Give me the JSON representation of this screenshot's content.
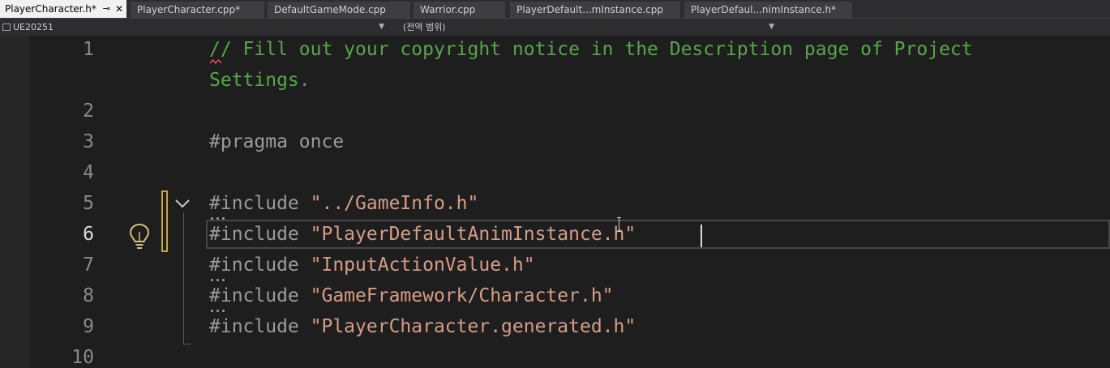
{
  "tabs": [
    {
      "label": "PlayerCharacter.h*",
      "active": true
    },
    {
      "label": "PlayerCharacter.cpp*"
    },
    {
      "label": "DefaultGameMode.cpp"
    },
    {
      "label": "Warrior.cpp"
    },
    {
      "label": "PlayerDefault...mInstance.cpp"
    },
    {
      "label": "PlayerDefaul...nimInstance.h*"
    }
  ],
  "tab_icons": {
    "pin": "⊸",
    "close": "✕"
  },
  "navbar": {
    "project": "UE20251",
    "scope": "(전역 범위)",
    "member": ""
  },
  "editor": {
    "current_line": 6,
    "line_numbers": [
      "1",
      "2",
      "3",
      "4",
      "5",
      "6",
      "7",
      "8",
      "9",
      "10"
    ],
    "lines": {
      "l1a": "// Fill out your copyright notice in the Description page of Project",
      "l1b": "Settings.",
      "l3_kw": "#pragma",
      "l3_rest": " once",
      "l5_kw": "#include",
      "l5_str": "\"../GameInfo.h\"",
      "l6_kw": "#include",
      "l6_str": "\"PlayerDefaultAnimInstance.h\"",
      "l7_kw": "#include",
      "l7_str": "\"InputActionValue.h\"",
      "l8_kw": "#include",
      "l8_str": "\"GameFramework/Character.h\"",
      "l9_kw": "#include",
      "l9_str": "\"PlayerCharacter.generated.h\""
    }
  },
  "colors": {
    "comment": "#57a64a",
    "string": "#d69d85",
    "change_bar": "#c8a93b",
    "background": "#1e1e1e"
  },
  "icons": [
    "pin-icon",
    "close-icon",
    "project-icon",
    "dropdown-icon",
    "fold-chevron-icon",
    "lightbulb-icon",
    "ibeam-cursor-icon"
  ]
}
